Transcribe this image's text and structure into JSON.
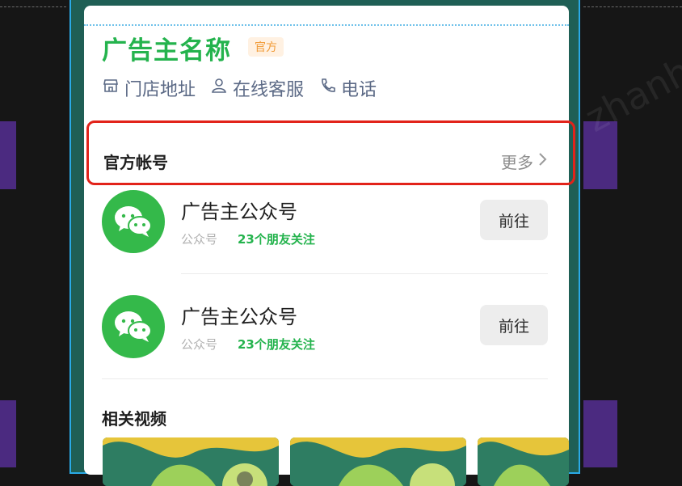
{
  "page": {
    "watermark_text": "zhanhuzhang",
    "watermark_text_2": "zhanh"
  },
  "advertiser": {
    "name": "广告主名称",
    "badge": "官方"
  },
  "contact_links": [
    {
      "label": "门店地址",
      "icon": "store-icon"
    },
    {
      "label": "在线客服",
      "icon": "person-icon"
    },
    {
      "label": "电话",
      "icon": "phone-icon"
    }
  ],
  "official_accounts": {
    "title": "官方帐号",
    "more_label": "更多",
    "items": [
      {
        "name": "广告主公众号",
        "type": "公众号",
        "followers": "23个朋友关注",
        "button": "前往",
        "icon": "wechat-icon"
      },
      {
        "name": "广告主公众号",
        "type": "公众号",
        "followers": "23个朋友关注",
        "button": "前往",
        "icon": "wechat-icon"
      }
    ]
  },
  "related_videos": {
    "title": "相关视频"
  },
  "colors": {
    "brand_green": "#24b34d",
    "badge_orange": "#f19a36",
    "highlight_red": "#e2231a",
    "frame_blue": "#2aa9e6"
  }
}
